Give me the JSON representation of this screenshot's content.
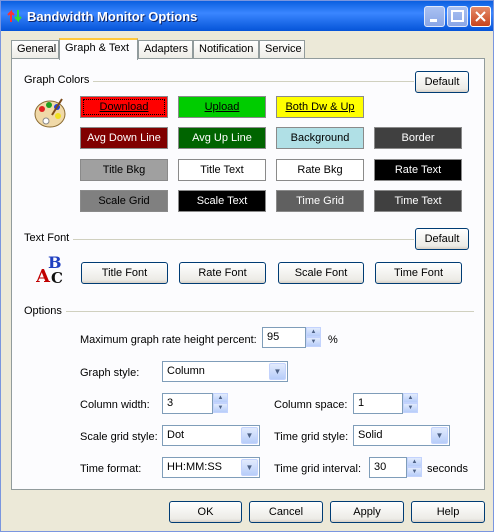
{
  "window": {
    "title": "Bandwidth Monitor Options"
  },
  "tabs": [
    "General",
    "Graph & Text",
    "Adapters",
    "Notification",
    "Service"
  ],
  "graph_colors": {
    "label": "Graph Colors",
    "default_label": "Default",
    "swatches": [
      {
        "label": "Download",
        "bg": "#ff0000",
        "fg": "#000000"
      },
      {
        "label": "Upload",
        "bg": "#00cc00",
        "fg": "#000000"
      },
      {
        "label": "Both Dw & Up",
        "bg": "#ffff00",
        "fg": "#000000"
      },
      {
        "label": "Avg Down Line",
        "bg": "#800000",
        "fg": "#ffffff"
      },
      {
        "label": "Avg Up Line",
        "bg": "#006400",
        "fg": "#ffffff"
      },
      {
        "label": "Background",
        "bg": "#b0e0e6",
        "fg": "#000000"
      },
      {
        "label": "Border",
        "bg": "#404040",
        "fg": "#ffffff"
      },
      {
        "label": "Title Bkg",
        "bg": "#a0a0a0",
        "fg": "#000000"
      },
      {
        "label": "Title Text",
        "bg": "#ffffff",
        "fg": "#000000"
      },
      {
        "label": "Rate Bkg",
        "bg": "#ffffff",
        "fg": "#000000"
      },
      {
        "label": "Rate Text",
        "bg": "#000000",
        "fg": "#ffffff"
      },
      {
        "label": "Scale Grid",
        "bg": "#808080",
        "fg": "#000000"
      },
      {
        "label": "Scale Text",
        "bg": "#000000",
        "fg": "#ffffff"
      },
      {
        "label": "Time Grid",
        "bg": "#606060",
        "fg": "#ffffff"
      },
      {
        "label": "Time Text",
        "bg": "#404040",
        "fg": "#ffffff"
      }
    ]
  },
  "text_font": {
    "label": "Text Font",
    "default_label": "Default",
    "buttons": [
      "Title Font",
      "Rate Font",
      "Scale Font",
      "Time Font"
    ]
  },
  "options": {
    "label": "Options",
    "max_rate_label": "Maximum graph rate height percent:",
    "max_rate_value": "95",
    "max_rate_unit": "%",
    "graph_style_label": "Graph style:",
    "graph_style_value": "Column",
    "column_width_label": "Column width:",
    "column_width_value": "3",
    "column_space_label": "Column space:",
    "column_space_value": "1",
    "scale_grid_style_label": "Scale grid style:",
    "scale_grid_style_value": "Dot",
    "time_grid_style_label": "Time grid style:",
    "time_grid_style_value": "Solid",
    "time_format_label": "Time format:",
    "time_format_value": "HH:MM:SS",
    "time_grid_interval_label": "Time grid interval:",
    "time_grid_interval_value": "30",
    "time_grid_interval_unit": "seconds"
  },
  "footer": {
    "ok": "OK",
    "cancel": "Cancel",
    "apply": "Apply",
    "help": "Help"
  }
}
